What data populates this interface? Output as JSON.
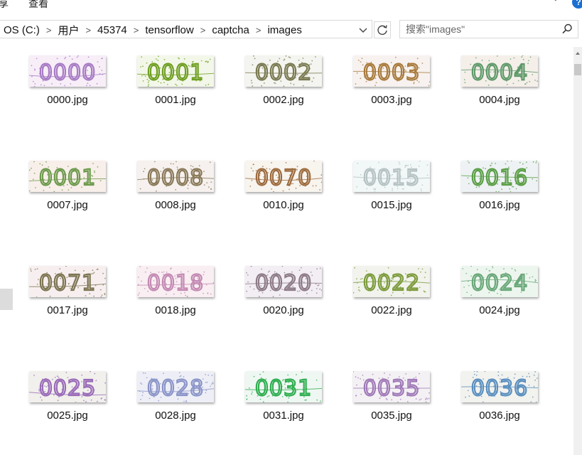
{
  "ribbon": {
    "tab_fragment": "享",
    "tab_view": "查看"
  },
  "address": {
    "crumbs": [
      "OS (C:)",
      "用户",
      "45374",
      "tensorflow",
      "captcha",
      "images"
    ]
  },
  "search": {
    "placeholder": "搜索\"images\""
  },
  "files": [
    {
      "name": "0000.jpg",
      "code": "0000",
      "color": "#a77bc4",
      "bg": "#f7eef7"
    },
    {
      "name": "0001.jpg",
      "code": "0001",
      "color": "#6f9f22",
      "bg": "#f3f7e9"
    },
    {
      "name": "0002.jpg",
      "code": "0002",
      "color": "#7a7a52",
      "bg": "#f4f4f0"
    },
    {
      "name": "0003.jpg",
      "code": "0003",
      "color": "#a87a3c",
      "bg": "#f7f2ef"
    },
    {
      "name": "0004.jpg",
      "code": "0004",
      "color": "#5f9a6a",
      "bg": "#f5efea"
    },
    {
      "name": "0007.jpg",
      "code": "0001",
      "color": "#6c9a4c",
      "bg": "#f8efea"
    },
    {
      "name": "0008.jpg",
      "code": "0008",
      "color": "#8a7a5a",
      "bg": "#f6f1ee"
    },
    {
      "name": "0010.jpg",
      "code": "0070",
      "color": "#9c6b3e",
      "bg": "#f8f4ee"
    },
    {
      "name": "0015.jpg",
      "code": "0015",
      "color": "#b6c2c2",
      "bg": "#f1f8f7"
    },
    {
      "name": "0016.jpg",
      "code": "0016",
      "color": "#5a9e46",
      "bg": "#eef2f4"
    },
    {
      "name": "0017.jpg",
      "code": "0071",
      "color": "#7d7552",
      "bg": "#f7efef"
    },
    {
      "name": "0018.jpg",
      "code": "0018",
      "color": "#c38ab3",
      "bg": "#f9eef2"
    },
    {
      "name": "0020.jpg",
      "code": "0020",
      "color": "#8d7b88",
      "bg": "#f2eef3"
    },
    {
      "name": "0022.jpg",
      "code": "0022",
      "color": "#7c9b3c",
      "bg": "#f1f3ec"
    },
    {
      "name": "0024.jpg",
      "code": "0024",
      "color": "#6aa87a",
      "bg": "#edf6ee"
    },
    {
      "name": "0025.jpg",
      "code": "0025",
      "color": "#9a6bb8",
      "bg": "#f1f0ec"
    },
    {
      "name": "0028.jpg",
      "code": "0028",
      "color": "#8a94c8",
      "bg": "#eeeff6"
    },
    {
      "name": "0031.jpg",
      "code": "0031",
      "color": "#2fae4f",
      "bg": "#eff7f3"
    },
    {
      "name": "0035.jpg",
      "code": "0035",
      "color": "#a07ab8",
      "bg": "#f4f1f4"
    },
    {
      "name": "0036.jpg",
      "code": "0036",
      "color": "#5a8fbf",
      "bg": "#f2f2ee"
    }
  ]
}
